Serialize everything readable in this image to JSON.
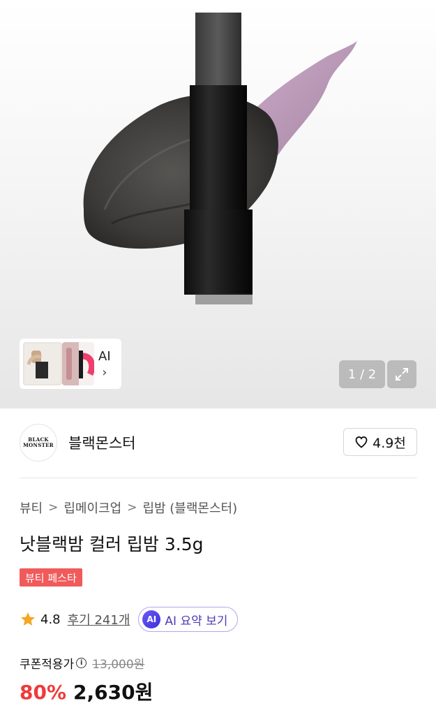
{
  "gallery": {
    "ai_label": "AI",
    "ai_chevron": "›",
    "pager": "1 / 2",
    "expand_icon": "expand-icon"
  },
  "brand": {
    "logo_line1": "BLACK",
    "logo_line2": "MONSTER",
    "name": "블랙몬스터",
    "like_count": "4.9천",
    "like_icon": "heart-icon"
  },
  "breadcrumb": [
    "뷰티",
    "립메이크업",
    "립밤 (블랙몬스터)"
  ],
  "breadcrumb_sep": ">",
  "product": {
    "title": "낫블랙밤 컬러 립밤 3.5g",
    "badge": "뷰티 페스타",
    "rating": "4.8",
    "reviews": "후기 241개",
    "ai_badge": "AI",
    "ai_summary": "AI 요약 보기"
  },
  "price": {
    "coupon_label": "쿠폰적용가",
    "info_icon": "i",
    "original": "13,000원",
    "discount": "80%",
    "final": "2,630원"
  },
  "colors": {
    "discount_red": "#f03a3a",
    "badge_red": "#f05a5a",
    "ai_purple": "#4b3bb5",
    "star": "#f5a623"
  }
}
